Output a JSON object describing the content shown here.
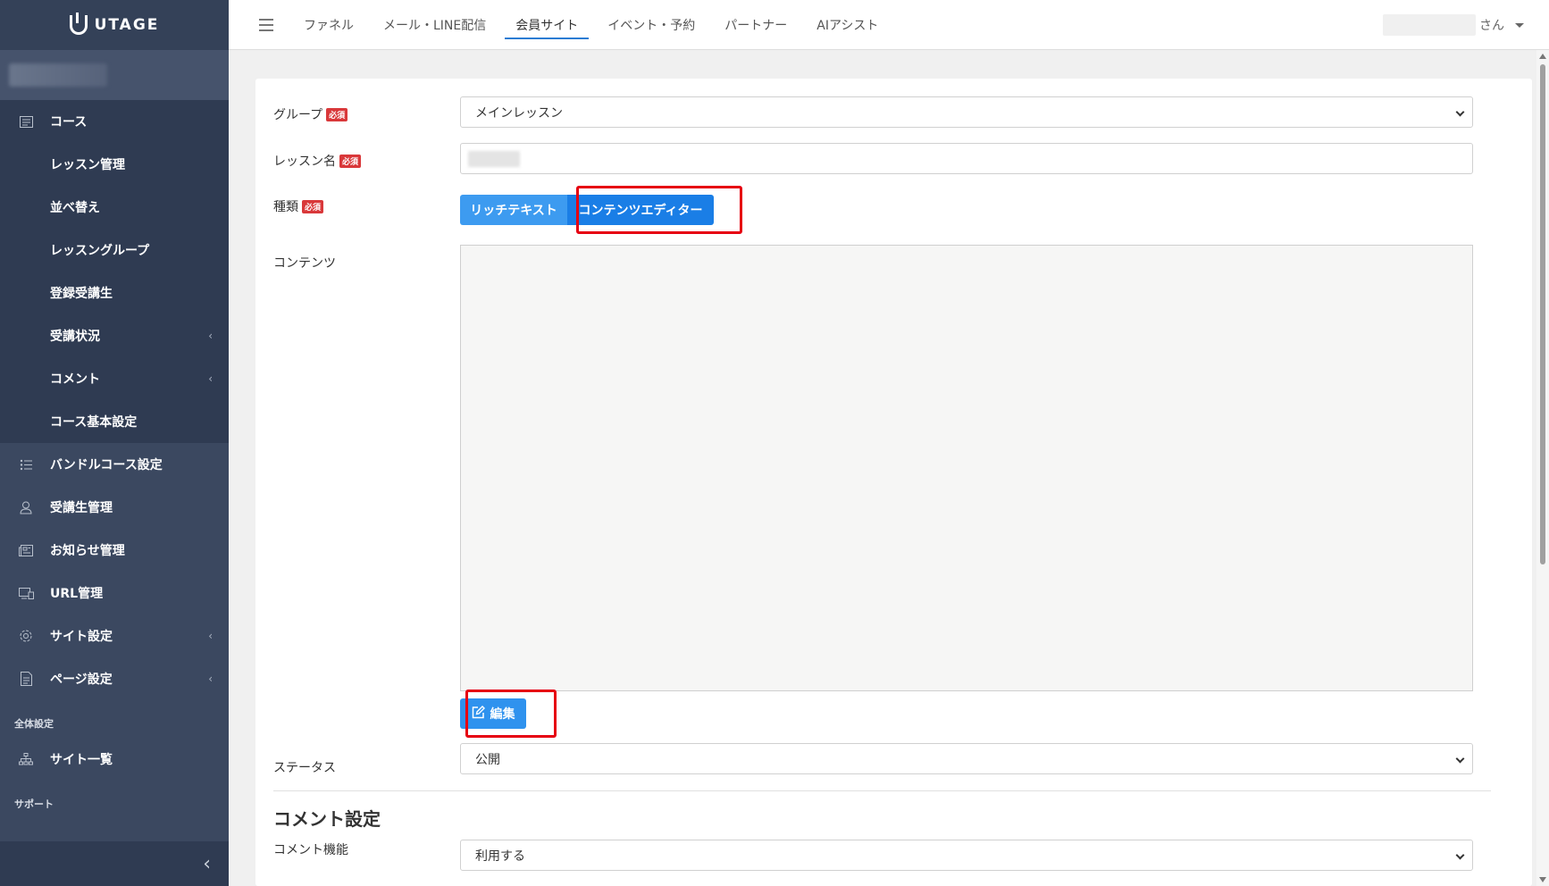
{
  "app": {
    "logo_text": "UTAGE"
  },
  "topnav": {
    "tabs": [
      {
        "label": "ファネル"
      },
      {
        "label": "メール・LINE配信"
      },
      {
        "label": "会員サイト"
      },
      {
        "label": "イベント・予約"
      },
      {
        "label": "パートナー"
      },
      {
        "label": "AIアシスト"
      }
    ],
    "active_tab": "会員サイト",
    "user_suffix": "さん"
  },
  "sidebar": {
    "course": {
      "label": "コース"
    },
    "course_sub": [
      {
        "label": "レッスン管理"
      },
      {
        "label": "並べ替え"
      },
      {
        "label": "レッスングループ"
      },
      {
        "label": "登録受講生"
      },
      {
        "label": "受講状況"
      },
      {
        "label": "コメント"
      },
      {
        "label": "コース基本設定"
      }
    ],
    "items": [
      {
        "label": "バンドルコース設定"
      },
      {
        "label": "受講生管理"
      },
      {
        "label": "お知らせ管理"
      },
      {
        "label": "URL管理"
      },
      {
        "label": "サイト設定"
      },
      {
        "label": "ページ設定"
      }
    ],
    "section_global": "全体設定",
    "site_list": "サイト一覧",
    "section_support": "サポート"
  },
  "form": {
    "required_badge": "必須",
    "group": {
      "label": "グループ",
      "value": "メインレッスン"
    },
    "lesson_name": {
      "label": "レッスン名"
    },
    "type": {
      "label": "種類",
      "option_rich": "リッチテキスト",
      "option_editor": "コンテンツエディター"
    },
    "content": {
      "label": "コンテンツ",
      "edit_button": "編集"
    },
    "status": {
      "label": "ステータス",
      "value": "公開"
    },
    "comment_section": {
      "title": "コメント設定"
    },
    "comment_feature": {
      "label": "コメント機能",
      "value": "利用する"
    }
  },
  "colors": {
    "sidebar_bg": "#3b4860",
    "primary": "#1a7ee6",
    "highlight": "#e60012",
    "required": "#d9383a"
  }
}
